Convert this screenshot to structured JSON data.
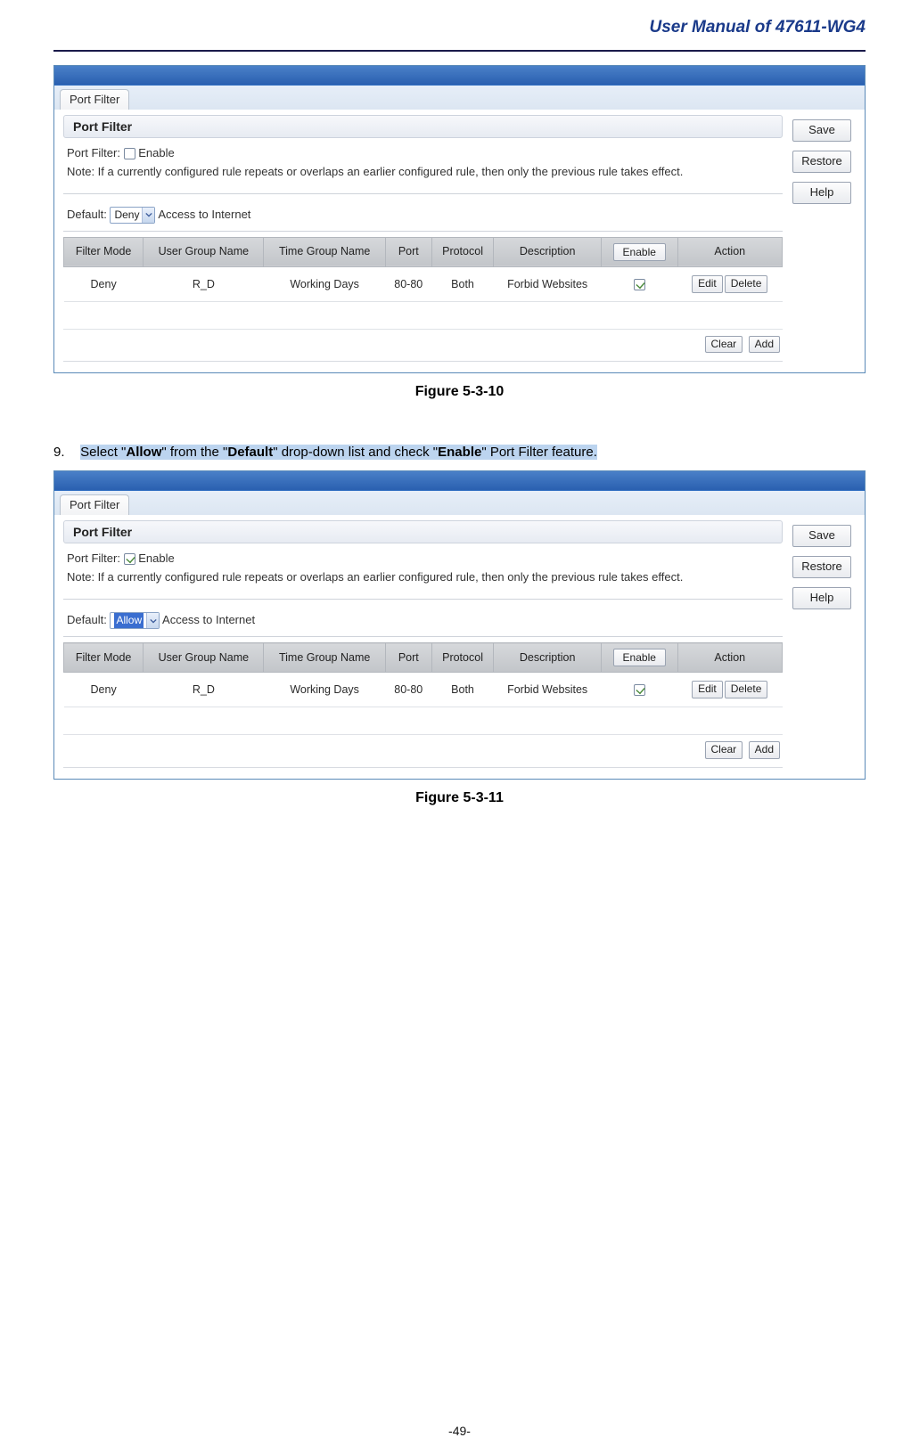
{
  "doc": {
    "header": "User Manual of 47611-WG4",
    "pagenum": "-49-"
  },
  "fig1": {
    "tab": "Port Filter",
    "section": "Port Filter",
    "filter_label": "Port Filter:",
    "enable_label": "Enable",
    "enable_checked": false,
    "note": "Note: If a currently configured rule repeats or overlaps an earlier configured rule, then only the previous rule takes effect.",
    "default_label": "Default:",
    "default_value": "Deny",
    "default_hl": false,
    "default_suffix": "Access to Internet",
    "table": {
      "headers": {
        "mode": "Filter Mode",
        "user": "User Group Name",
        "time": "Time Group Name",
        "port": "Port",
        "proto": "Protocol",
        "desc": "Description",
        "enable": "Enable",
        "action": "Action"
      },
      "row": {
        "mode": "Deny",
        "user": "R_D",
        "time": "Working Days",
        "port": "80-80",
        "proto": "Both",
        "desc": "Forbid Websites",
        "enabled": true,
        "edit": "Edit",
        "delete": "Delete"
      }
    },
    "footer": {
      "clear": "Clear",
      "add": "Add"
    },
    "side": {
      "save": "Save",
      "restore": "Restore",
      "help": "Help"
    },
    "caption": "Figure 5-3-10"
  },
  "step9": {
    "num": "9.",
    "pre": "Select \"",
    "b1": "Allow",
    "mid1": "\" from the \"",
    "b2": "Default",
    "mid2": "\" drop-down list and check \"",
    "b3": "Enable",
    "post": "\" Port Filter feature."
  },
  "fig2": {
    "tab": "Port Filter",
    "section": "Port Filter",
    "filter_label": "Port Filter:",
    "enable_label": "Enable",
    "enable_checked": true,
    "note": "Note: If a currently configured rule repeats or overlaps an earlier configured rule, then only the previous rule takes effect.",
    "default_label": "Default:",
    "default_value": "Allow",
    "default_hl": true,
    "default_suffix": "Access to Internet",
    "table": {
      "headers": {
        "mode": "Filter Mode",
        "user": "User Group Name",
        "time": "Time Group Name",
        "port": "Port",
        "proto": "Protocol",
        "desc": "Description",
        "enable": "Enable",
        "action": "Action"
      },
      "row": {
        "mode": "Deny",
        "user": "R_D",
        "time": "Working Days",
        "port": "80-80",
        "proto": "Both",
        "desc": "Forbid Websites",
        "enabled": true,
        "edit": "Edit",
        "delete": "Delete"
      }
    },
    "footer": {
      "clear": "Clear",
      "add": "Add"
    },
    "side": {
      "save": "Save",
      "restore": "Restore",
      "help": "Help"
    },
    "caption": "Figure 5-3-11"
  }
}
